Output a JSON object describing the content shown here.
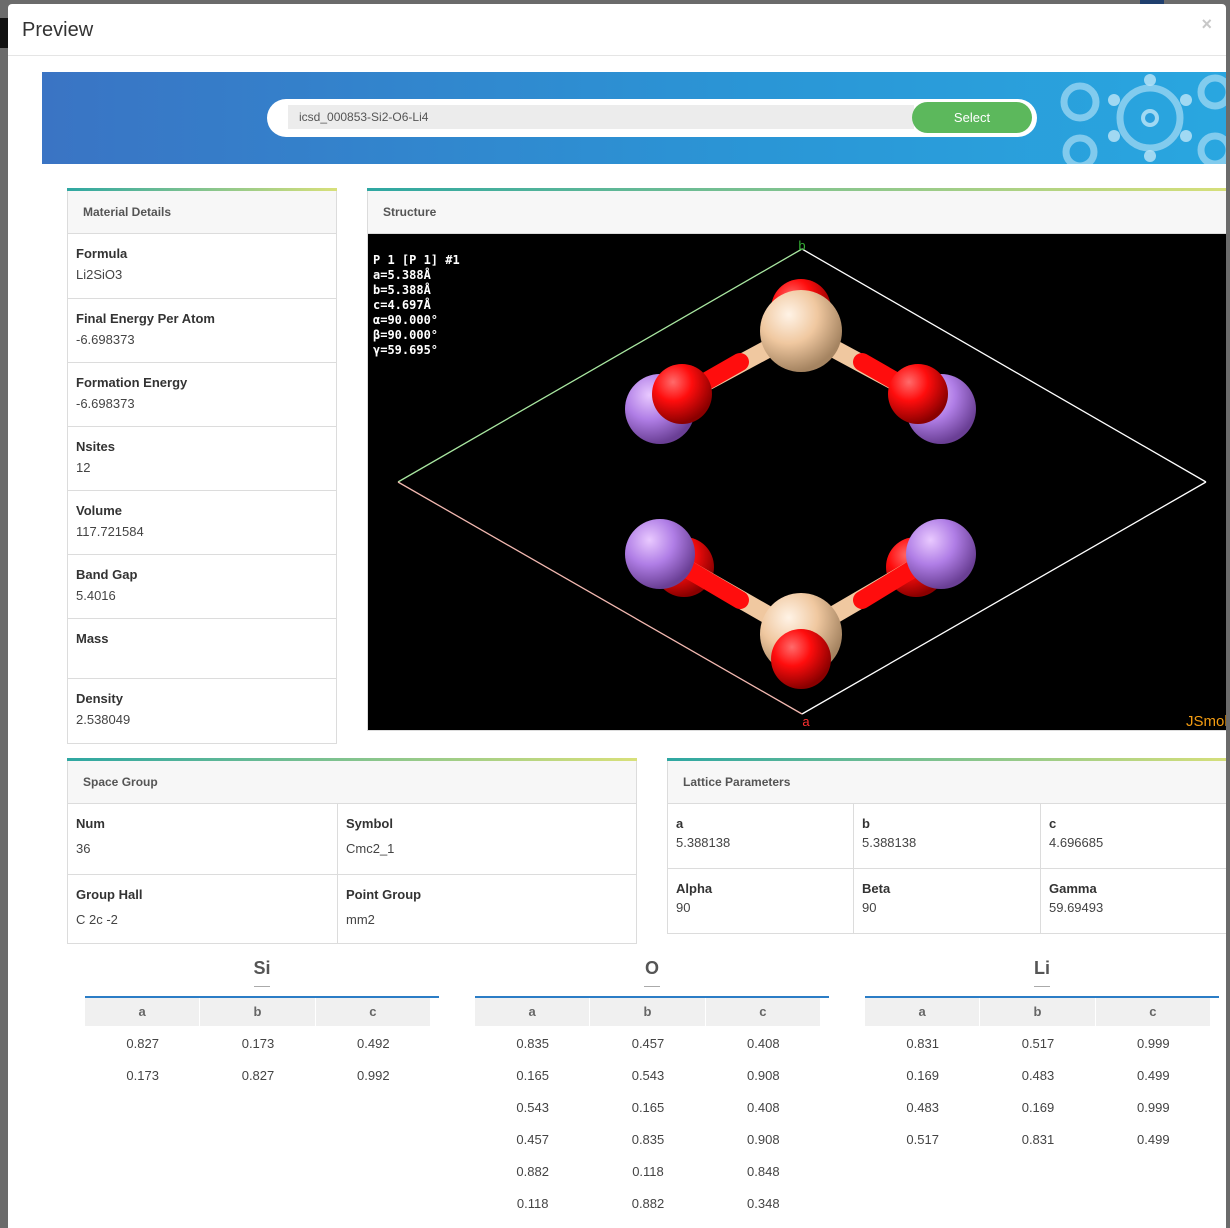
{
  "modal": {
    "title": "Preview",
    "close_label": "×"
  },
  "search": {
    "value": "icsd_000853-Si2-O6-Li4",
    "button_label": "Select"
  },
  "material_details": {
    "title": "Material Details",
    "rows": [
      {
        "label": "Formula",
        "value": "Li2SiO3"
      },
      {
        "label": "Final Energy Per Atom",
        "value": "-6.698373"
      },
      {
        "label": "Formation Energy",
        "value": "-6.698373"
      },
      {
        "label": "Nsites",
        "value": "12"
      },
      {
        "label": "Volume",
        "value": "117.721584"
      },
      {
        "label": "Band Gap",
        "value": "5.4016"
      },
      {
        "label": "Mass",
        "value": ""
      },
      {
        "label": "Density",
        "value": "2.538049"
      }
    ]
  },
  "structure": {
    "title": "Structure",
    "info_lines": [
      "P 1 [P 1] #1",
      "a=5.388Å",
      "b=5.388Å",
      "c=4.697Å",
      "α=90.000°",
      "β=90.000°",
      "γ=59.695°"
    ],
    "axis_b": "b",
    "axis_a": "a",
    "watermark": "JSmol"
  },
  "space_group": {
    "title": "Space Group",
    "cells": [
      {
        "label": "Num",
        "value": "36"
      },
      {
        "label": "Symbol",
        "value": "Cmc2_1"
      },
      {
        "label": "Group Hall",
        "value": "C 2c -2"
      },
      {
        "label": "Point Group",
        "value": "mm2"
      }
    ]
  },
  "lattice": {
    "title": "Lattice Parameters",
    "cells": [
      {
        "label": "a",
        "value": "5.388138"
      },
      {
        "label": "b",
        "value": "5.388138"
      },
      {
        "label": "c",
        "value": "4.696685"
      },
      {
        "label": "Alpha",
        "value": "90"
      },
      {
        "label": "Beta",
        "value": "90"
      },
      {
        "label": "Gamma",
        "value": "59.69493"
      }
    ]
  },
  "atoms": {
    "columns": [
      "a",
      "b",
      "c"
    ],
    "si": {
      "name": "Si",
      "rows": [
        [
          "0.827",
          "0.173",
          "0.492"
        ],
        [
          "0.173",
          "0.827",
          "0.992"
        ]
      ]
    },
    "o": {
      "name": "O",
      "rows": [
        [
          "0.835",
          "0.457",
          "0.408"
        ],
        [
          "0.165",
          "0.543",
          "0.908"
        ],
        [
          "0.543",
          "0.165",
          "0.408"
        ],
        [
          "0.457",
          "0.835",
          "0.908"
        ],
        [
          "0.882",
          "0.118",
          "0.848"
        ],
        [
          "0.118",
          "0.882",
          "0.348"
        ]
      ]
    },
    "li": {
      "name": "Li",
      "rows": [
        [
          "0.831",
          "0.517",
          "0.999"
        ],
        [
          "0.169",
          "0.483",
          "0.499"
        ],
        [
          "0.483",
          "0.169",
          "0.999"
        ],
        [
          "0.517",
          "0.831",
          "0.499"
        ]
      ]
    }
  },
  "colors": {
    "accent": "#5cb85c",
    "table_rule": "#2b7dc6",
    "oxygen": "#ff0d0d",
    "silicon": "#f0c8a0",
    "lithium": "#cc80ff"
  }
}
